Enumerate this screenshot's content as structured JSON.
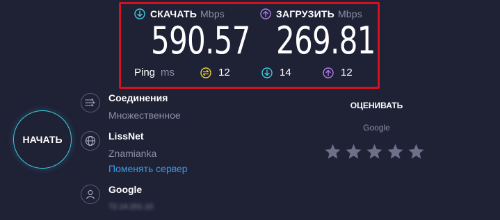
{
  "results": {
    "download": {
      "label": "СКАЧАТЬ",
      "unit": "Mbps",
      "value": "590.57",
      "color": "#3ccce0"
    },
    "upload": {
      "label": "ЗАГРУЗИТЬ",
      "unit": "Mbps",
      "value": "269.81",
      "color": "#b07ce8"
    },
    "ping": {
      "label": "Ping",
      "unit": "ms",
      "idle": "12",
      "download": "14",
      "upload": "12",
      "idle_color": "#e8d33c"
    },
    "highlight_color": "#d4111f"
  },
  "start": {
    "label": "НАЧАТЬ"
  },
  "connections": {
    "title": "Соединения",
    "value": "Множественное"
  },
  "server": {
    "name": "LissNet",
    "location": "Znamianka",
    "change_link": "Поменять сервер"
  },
  "provider": {
    "name": "Google",
    "ip": "72.14.201.10"
  },
  "rating": {
    "label": "ОЦЕНИВАТЬ",
    "isp": "Google",
    "stars": 5
  },
  "icons": {
    "download": "arrow-down-circle-icon",
    "upload": "arrow-up-circle-icon",
    "ping": "ping-icon",
    "connections": "connections-icon",
    "server": "globe-icon",
    "provider": "person-icon",
    "star": "star-icon"
  }
}
